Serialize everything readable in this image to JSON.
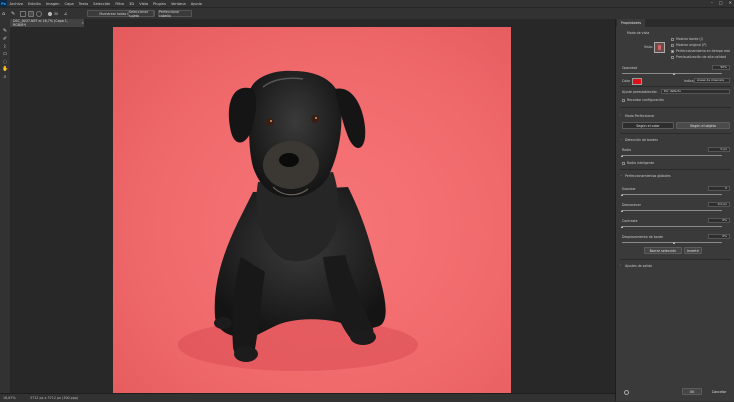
{
  "menu": [
    "Archivo",
    "Edición",
    "Imagen",
    "Capa",
    "Texto",
    "Selección",
    "Filtro",
    "3D",
    "Vista",
    "Plugins",
    "Ventana",
    "Ayuda"
  ],
  "options_bar": {
    "size_value": "30",
    "sample_all_layers": "Muestrear todas las capas",
    "select_subject": "Seleccionar sujeto",
    "refine_hair": "Perfeccionar cabello"
  },
  "document_tab": "DSC_0037.NEF al 16,7% (Capa 1, RGB/8*)",
  "status_bar": {
    "zoom": "16,67%",
    "dimensions": "3712 px x 3712 px (300 ppp)"
  },
  "panel": {
    "tab": "Propiedades",
    "view_mode_label": "Modo de vista",
    "view_label": "Vista:",
    "show_edge": "Mostrar borde (J)",
    "show_original": "Mostrar original (P)",
    "realtime_refinement": "Perfeccionamiento en tiempo real",
    "high_quality_preview": "Previsualización de alta calidad",
    "opacity_label": "Opacidad",
    "opacity_value": "50%",
    "color_label": "Color",
    "color_value": "#e0101a",
    "indicates_label": "Indica:",
    "indicates_value": "Áreas de máscara",
    "preset_label": "Ajuste preestablecido:",
    "preset_value": "Por defecto",
    "remember_settings": "Recordar configuración",
    "refine_mode_label": "Modo Perfeccionar",
    "mode_color": "Según el color",
    "mode_object": "Según el objeto",
    "edge_detection": "Detección de bordes",
    "radius_label": "Radio",
    "radius_value": "0 px",
    "smart_radius": "Radio inteligente",
    "global_refinements": "Perfeccionamientos globales",
    "smooth_label": "Suavizar",
    "smooth_value": "0",
    "feather_label": "Desvanecer",
    "feather_value": "0,0 px",
    "contrast_label": "Contraste",
    "contrast_value": "0%",
    "shift_edge_label": "Desplazamiento de borde",
    "shift_edge_value": "0%",
    "clear_selection": "Borrar selección",
    "invert": "Invertir",
    "output_settings": "Ajustes de salida",
    "ok": "OK",
    "cancel": "Cancelar"
  }
}
